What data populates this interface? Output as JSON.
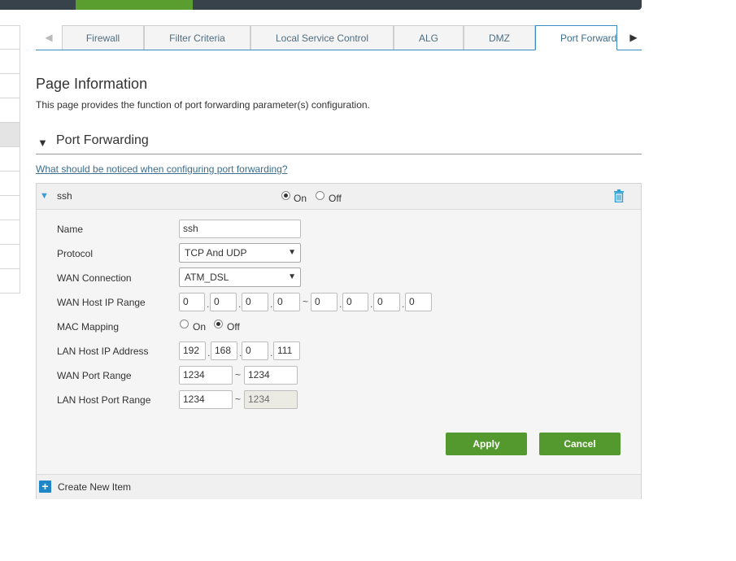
{
  "tabs": {
    "prev_arrow": "◀",
    "next_arrow": "▶",
    "items": [
      {
        "label": "Firewall"
      },
      {
        "label": "Filter Criteria"
      },
      {
        "label": "Local Service Control"
      },
      {
        "label": "ALG"
      },
      {
        "label": "DMZ"
      },
      {
        "label": "Port Forward"
      }
    ]
  },
  "page": {
    "title": "Page Information",
    "description": "This page provides the function of port forwarding parameter(s) configuration."
  },
  "section": {
    "title": "Port Forwarding",
    "help_link": "What should be noticed when configuring port forwarding?"
  },
  "item": {
    "name": "ssh",
    "on_label": "On",
    "off_label": "Off",
    "enabled": true
  },
  "form": {
    "name_label": "Name",
    "name_value": "ssh",
    "protocol_label": "Protocol",
    "protocol_value": "TCP And UDP",
    "wan_conn_label": "WAN Connection",
    "wan_conn_value": "ATM_DSL",
    "wan_ip_label": "WAN Host IP Range",
    "wan_ip_start": [
      "0",
      "0",
      "0",
      "0"
    ],
    "wan_ip_end": [
      "0",
      "0",
      "0",
      "0"
    ],
    "mac_label": "MAC Mapping",
    "mac_on": "On",
    "mac_off": "Off",
    "lan_ip_label": "LAN Host IP Address",
    "lan_ip": [
      "192",
      "168",
      "0",
      "111"
    ],
    "wan_port_label": "WAN Port Range",
    "wan_port_start": "1234",
    "wan_port_end": "1234",
    "lan_port_label": "LAN Host Port Range",
    "lan_port_start": "1234",
    "lan_port_end": "1234",
    "dot": ".",
    "tilde": "~",
    "dropdown_caret": "▼"
  },
  "buttons": {
    "apply": "Apply",
    "cancel": "Cancel"
  },
  "footer": {
    "create_label": "Create New Item",
    "plus": "+"
  },
  "colors": {
    "accent_green": "#53992d",
    "link_blue": "#3c6d8c",
    "tab_border": "#3a8ec1"
  }
}
